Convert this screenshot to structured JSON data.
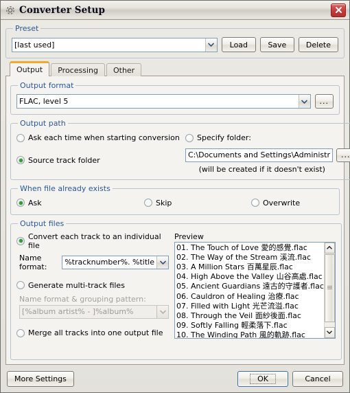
{
  "window": {
    "title": "Converter Setup",
    "icon": "gear-icon",
    "close_label": "Close"
  },
  "preset": {
    "legend": "Preset",
    "value": "[last used]",
    "buttons": [
      {
        "label": "Load",
        "name": "load-preset-button"
      },
      {
        "label": "Save",
        "name": "save-preset-button"
      },
      {
        "label": "Delete",
        "name": "delete-preset-button"
      }
    ]
  },
  "tabs": [
    {
      "label": "Output",
      "active": true
    },
    {
      "label": "Processing",
      "active": false
    },
    {
      "label": "Other",
      "active": false
    }
  ],
  "output_format": {
    "legend": "Output format",
    "value": "FLAC, level 5",
    "browse_label": "..."
  },
  "output_path": {
    "legend": "Output path",
    "ask_each_time": "Ask each time when starting conversion",
    "source_track_folder": "Source track folder",
    "specify_folder": "Specify folder:",
    "folder_value": "C:\\Documents and Settings\\Administr",
    "browse_label": "...",
    "note": "(will be created if it doesn't exist)",
    "selected": "source_track_folder"
  },
  "when_exists": {
    "legend": "When file already exists",
    "options": [
      "Ask",
      "Skip",
      "Overwrite"
    ],
    "selected": "Ask"
  },
  "output_files": {
    "legend": "Output files",
    "convert_each": "Convert each track to an individual file",
    "name_format_label": "Name format:",
    "name_format_value": "%tracknumber%. %title",
    "generate_multi": "Generate multi-track files",
    "grouping_label": "Name format & grouping pattern:",
    "grouping_value": "[%album artist% - ]%album%",
    "merge_all": "Merge all tracks into one output file",
    "selected": "convert_each"
  },
  "preview": {
    "label": "Preview",
    "items": [
      "01. The Touch of Love 愛的感覺.flac",
      "02. The Way of the Stream 溪流.flac",
      "03. A Million Stars 百萬星辰.flac",
      "04. High Above the Valley 山谷高處.flac",
      "05. Ancient Guardians 遠古的守護者.flac",
      "06. Cauldron of Healing 治療.flac",
      "07. Filled with Light 光芒流溢.flac",
      "08. Through the Veil 面紗後面.flac",
      "09. Softly Falling 輕柔落下.flac",
      "10. The Winding Path 風的軌跡.flac"
    ]
  },
  "footer": {
    "more_settings": "More Settings",
    "ok": "OK",
    "cancel": "Cancel"
  },
  "colors": {
    "legend_blue": "#2b5797",
    "active_tab_accent": "#f0a830",
    "radio_green": "#2f9e2f",
    "close_red": "#c43a3a"
  }
}
